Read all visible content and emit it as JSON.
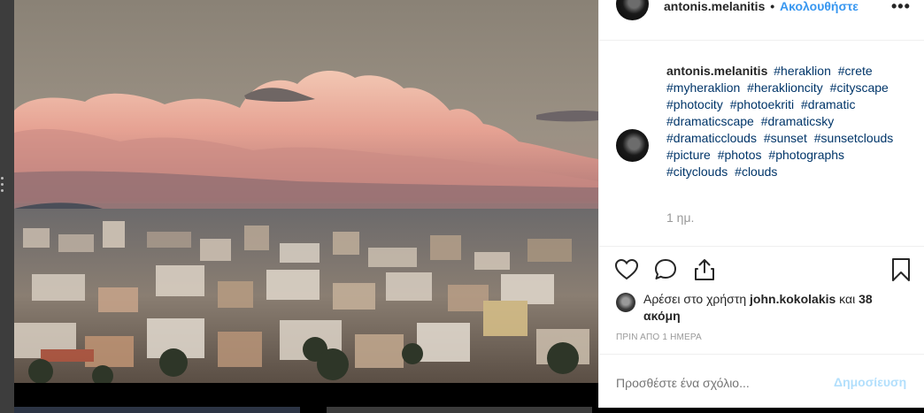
{
  "header": {
    "username": "antonis.melanitis",
    "separator": "•",
    "follow_label": "Ακολουθήστε",
    "more_label": "•••"
  },
  "caption": {
    "username": "antonis.melanitis",
    "hashtags": [
      "#heraklion",
      "#crete",
      "#myheraklion",
      "#heraklioncity",
      "#cityscape",
      "#photocity",
      "#photoekriti",
      "#dramatic",
      "#dramaticscape",
      "#dramaticsky",
      "#dramaticclouds",
      "#sunset",
      "#sunsetclouds",
      "#picture",
      "#photos",
      "#photographs",
      "#cityclouds",
      "#clouds"
    ],
    "time": "1 ημ."
  },
  "actions": {
    "icons": [
      "heart-icon",
      "comment-icon",
      "share-icon",
      "bookmark-icon"
    ]
  },
  "likes": {
    "prefix": "Αρέσει στο χρήστη",
    "user": "john.kokolakis",
    "suffix": "και",
    "others": "38 ακόμη"
  },
  "timestamp": "ΠΡΙΝ ΑΠΟ 1 ΗΜΕΡΑ",
  "comment": {
    "placeholder": "Προσθέστε ένα σχόλιο...",
    "post_label": "Δημοσίευση"
  },
  "colors": {
    "link": "#003569",
    "follow": "#3897f0",
    "post_disabled": "#b2dffc",
    "muted": "#999999"
  }
}
